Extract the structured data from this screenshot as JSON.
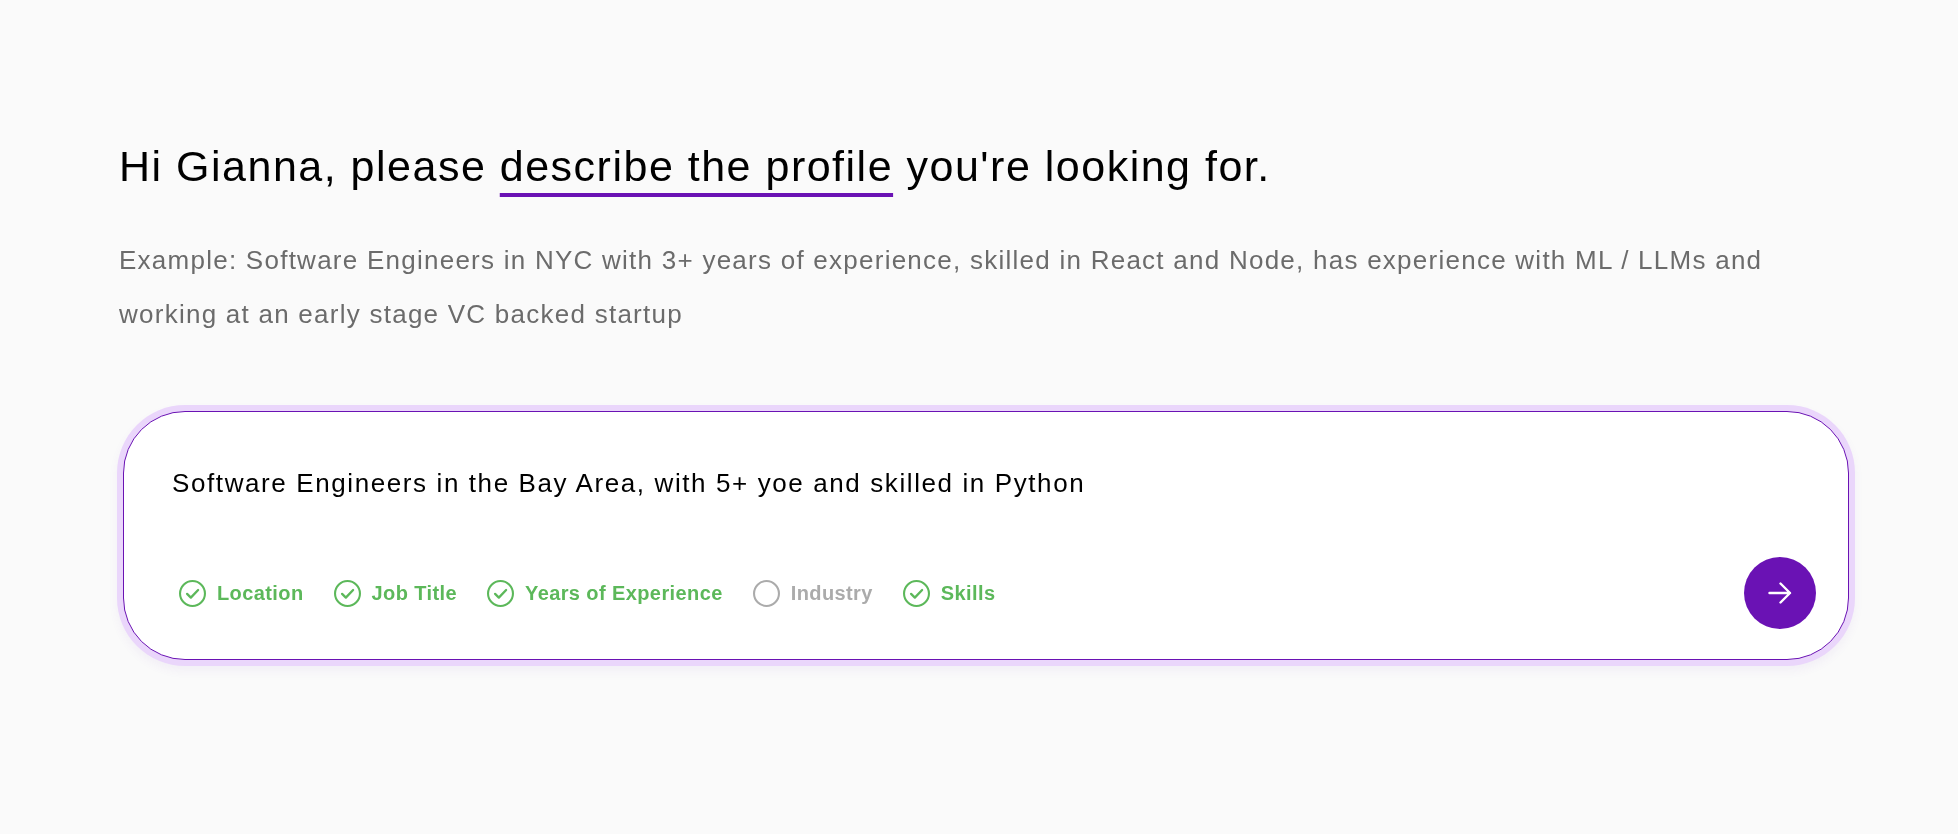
{
  "heading": {
    "lead": "Hi Gianna, please",
    "highlight": "describe the profile",
    "tail": "you're looking for."
  },
  "example": "Example: Software Engineers in NYC with 3+ years of experience, skilled in React and Node, has experience with ML / LLMs and working at an early stage VC backed startup",
  "prompt": {
    "value": "Software Engineers in the Bay Area, with 5+ yoe and skilled in Python",
    "criteria": [
      {
        "label": "Location",
        "checked": true
      },
      {
        "label": "Job Title",
        "checked": true
      },
      {
        "label": "Years of Experience",
        "checked": true
      },
      {
        "label": "Industry",
        "checked": false
      },
      {
        "label": "Skills",
        "checked": true
      }
    ]
  }
}
